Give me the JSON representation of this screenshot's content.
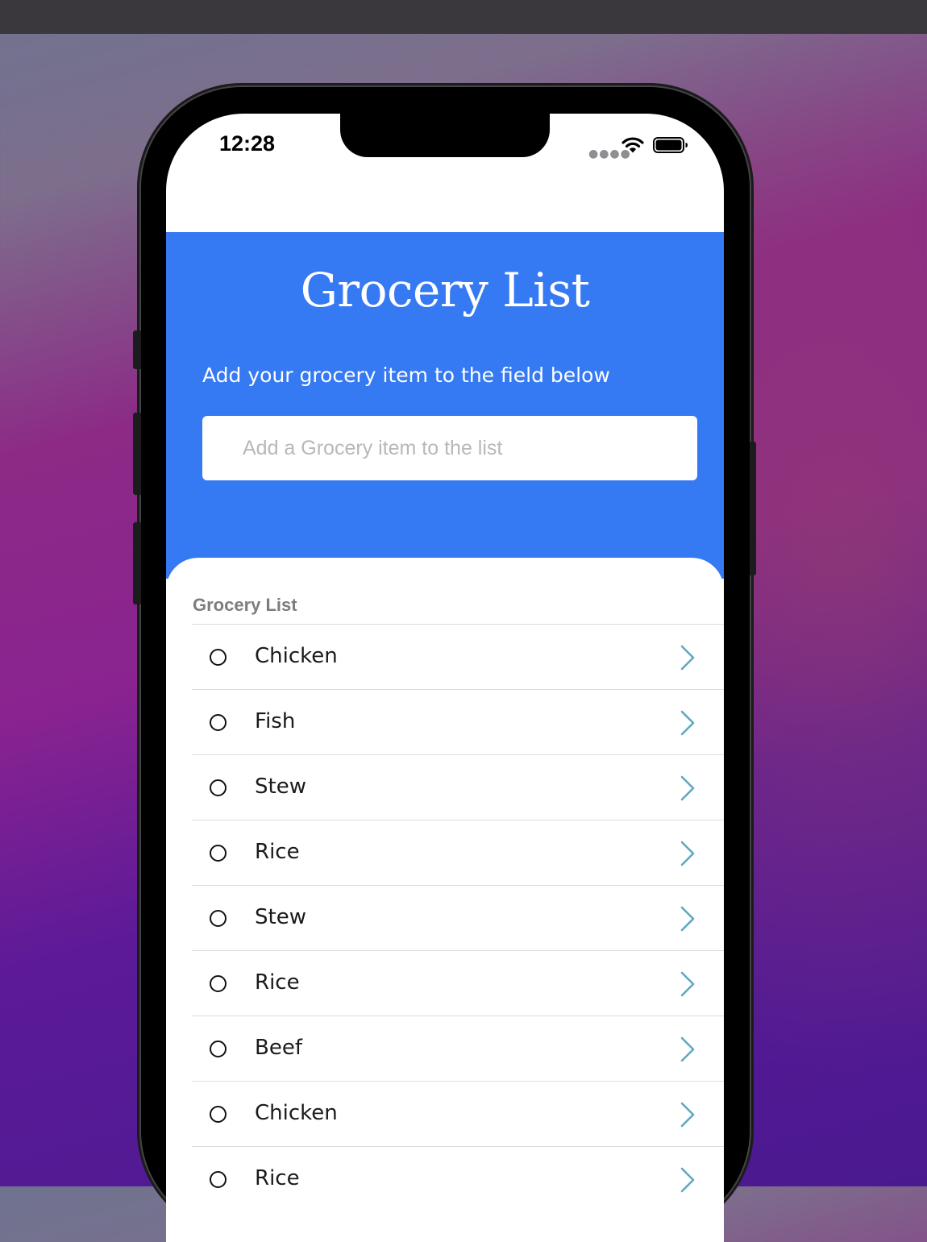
{
  "status_bar": {
    "time": "12:28"
  },
  "header": {
    "title": "Grocery List",
    "subtitle": "Add your grocery item to the field below",
    "input_placeholder": "Add a Grocery item to the list",
    "input_value": ""
  },
  "list": {
    "section_title": "Grocery List",
    "items": [
      {
        "label": "Chicken"
      },
      {
        "label": "Fish"
      },
      {
        "label": "Stew"
      },
      {
        "label": "Rice"
      },
      {
        "label": "Stew"
      },
      {
        "label": "Rice"
      },
      {
        "label": "Beef"
      },
      {
        "label": "Chicken"
      },
      {
        "label": "Rice"
      }
    ]
  },
  "colors": {
    "header_blue": "#3579f3",
    "chevron": "#5fa8c0"
  },
  "icons": {
    "row_leading": "circle-outline-icon",
    "row_trailing": "chevron-right-icon",
    "status": [
      "signal-dots-icon",
      "wifi-icon",
      "battery-icon"
    ]
  }
}
